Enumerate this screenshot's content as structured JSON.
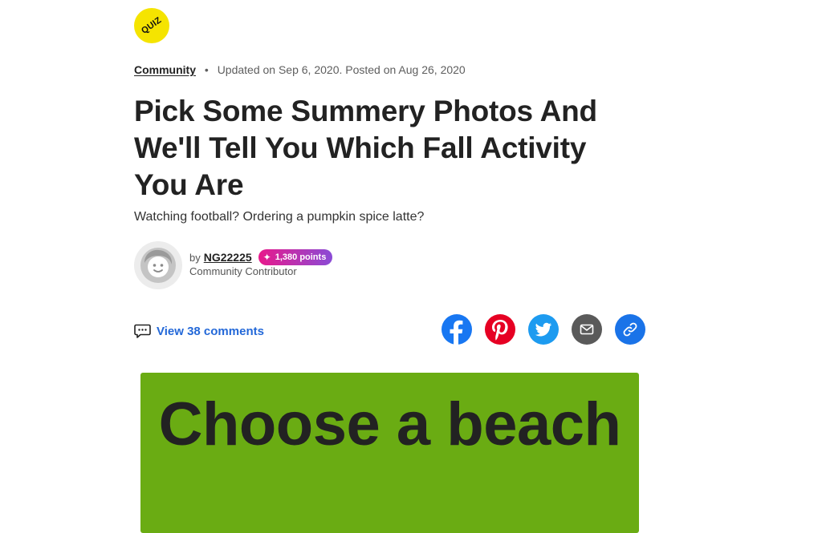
{
  "badge": {
    "label": "QUIZ",
    "color": "#f5e400"
  },
  "meta": {
    "category": "Community",
    "separator": "•",
    "dates": "Updated on Sep 6, 2020. Posted on Aug 26, 2020"
  },
  "article": {
    "title": "Pick Some Summery Photos And We'll Tell You Which Fall Activity You Are",
    "subtitle": "Watching football? Ordering a pumpkin spice latte?"
  },
  "author": {
    "by": "by",
    "username": "NG22225",
    "points": "1,380 points",
    "role": "Community Contributor"
  },
  "comments": {
    "label": "View 38 comments",
    "icon": "comment-icon"
  },
  "share": {
    "icons": [
      "facebook-icon",
      "pinterest-icon",
      "twitter-icon",
      "email-icon",
      "link-icon"
    ]
  },
  "hero": {
    "text": "Choose a beach",
    "background": "#6aac13"
  },
  "colors": {
    "link_blue": "#2368d8",
    "points_gradient_start": "#e8198b",
    "points_gradient_end": "#8a4bd6"
  }
}
